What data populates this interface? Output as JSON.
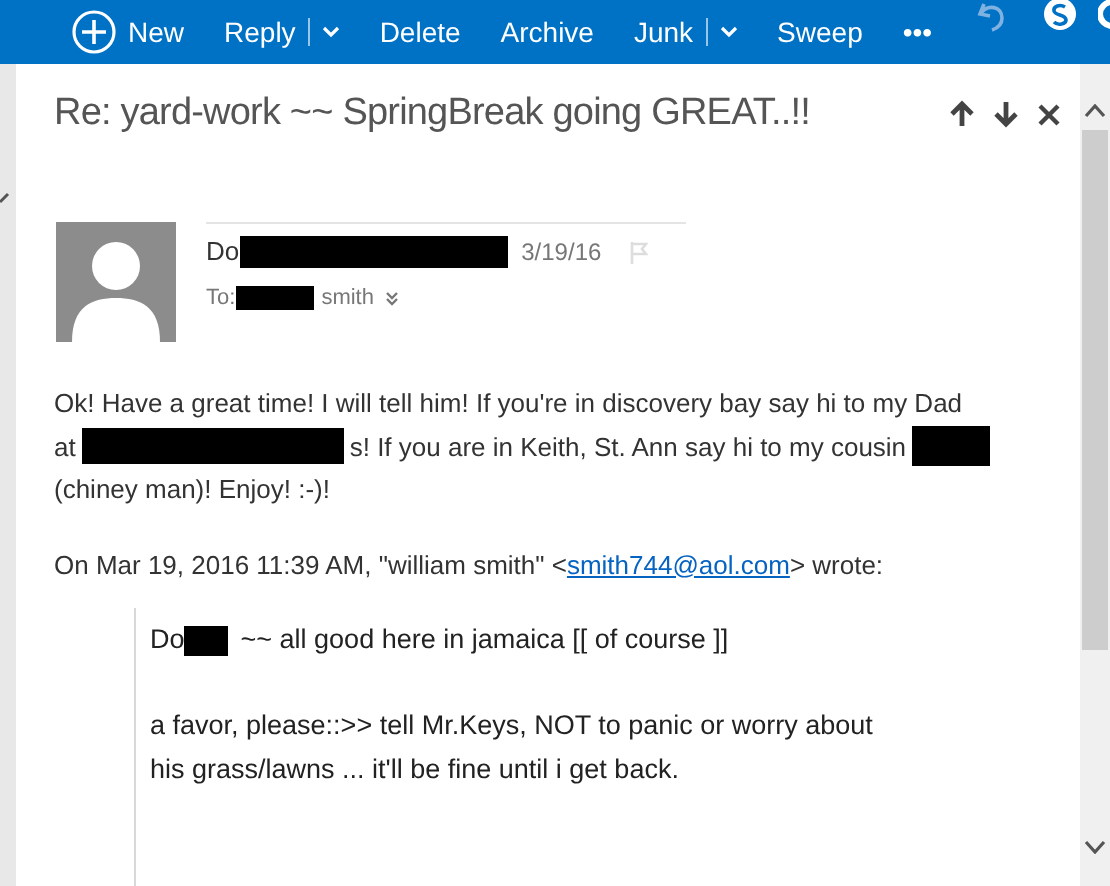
{
  "toolbar": {
    "items": [
      {
        "label": "New",
        "kind": "new",
        "dropdown": false
      },
      {
        "label": "Reply",
        "kind": "plain",
        "dropdown": true
      },
      {
        "label": "Delete",
        "kind": "plain",
        "dropdown": false
      },
      {
        "label": "Archive",
        "kind": "plain",
        "dropdown": false
      },
      {
        "label": "Junk",
        "kind": "plain",
        "dropdown": true
      },
      {
        "label": "Sweep",
        "kind": "plain",
        "dropdown": false
      },
      {
        "label": "•••",
        "kind": "plain",
        "dropdown": false
      }
    ]
  },
  "message": {
    "subject": "Re: yard-work ~~ SpringBreak going GREAT..!!",
    "sender": [
      {
        "kind": "text",
        "text": "Do"
      },
      {
        "kind": "redaction"
      }
    ],
    "date": "3/19/16",
    "to": [
      {
        "kind": "text",
        "text": "To:"
      },
      {
        "kind": "redaction"
      },
      {
        "kind": "text",
        "text": "smith"
      }
    ],
    "body": [
      [
        {
          "kind": "text",
          "text": "Ok! Have a great time! I will tell him! If you're in discovery bay say hi to my Dad"
        }
      ],
      [
        {
          "kind": "text",
          "text": "at"
        },
        {
          "kind": "redaction"
        },
        {
          "kind": "text",
          "text": "s! If you are in Keith, St. Ann say hi to my cousin"
        },
        {
          "kind": "redaction"
        }
      ],
      [
        {
          "kind": "text",
          "text": "(chiney man)! Enjoy! :-)!"
        }
      ]
    ],
    "attribution": {
      "before": "On Mar 19, 2016 11:39 AM, \"william smith\" <",
      "link": "smith744@aol.com",
      "after": "> wrote:"
    },
    "quote": [
      [
        [
          {
            "kind": "text",
            "text": "Do"
          },
          {
            "kind": "redaction"
          },
          {
            "kind": "text",
            "text": "~~ all good here in jamaica [[ of course ]]"
          }
        ]
      ],
      [
        [
          {
            "kind": "text",
            "text": "a favor, please::>> tell Mr.Keys, NOT to panic or worry about"
          }
        ],
        [
          {
            "kind": "text",
            "text": "his grass/lawns ... it'll be fine until i get back."
          }
        ]
      ]
    ]
  }
}
